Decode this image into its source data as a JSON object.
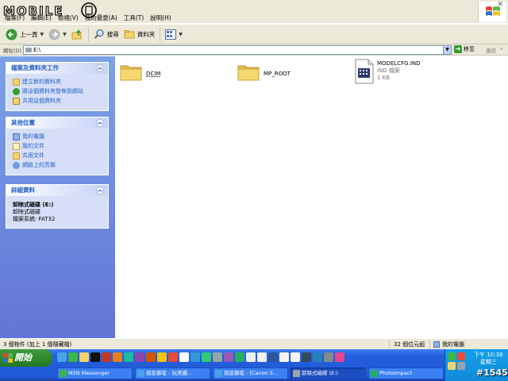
{
  "menubar": {
    "items": [
      "檔案(F)",
      "編輯(E)",
      "檢視(V)",
      "我的最愛(A)",
      "工具(T)",
      "說明(H)"
    ],
    "watermark_text": "MOBILE01"
  },
  "toolbar": {
    "back_label": "上一頁",
    "search_label": "搜尋",
    "folders_label": "資料夾"
  },
  "address": {
    "label": "網址(D)",
    "value": "E:\\",
    "go_label": "移至",
    "links_label": "連結"
  },
  "tasks_panel": {
    "title": "檔案及資料夾工作",
    "items": [
      "建立新的資料夾",
      "將這個資料夾發佈到網站",
      "共用這個資料夾"
    ]
  },
  "places_panel": {
    "title": "其他位置",
    "items": [
      "我的電腦",
      "我的文件",
      "共用文件",
      "網路上的芳鄰"
    ]
  },
  "details_panel": {
    "title": "詳細資料",
    "name": "卸除式磁碟 (E:)",
    "type": "卸除式磁碟",
    "filesystem": "檔案系統: FAT32"
  },
  "files": [
    {
      "name": "DCIM",
      "kind": "folder"
    },
    {
      "name": "MP_ROOT",
      "kind": "folder"
    },
    {
      "name": "MODELCFG.IND",
      "kind": "file",
      "type": "IND 檔案",
      "size": "1 KB"
    }
  ],
  "status": {
    "left": "3 個物件 (加上 1 個隱藏檔)",
    "size": "32 個位元組",
    "location": "我的電腦"
  },
  "taskbar": {
    "start_label": "開始",
    "tasks": [
      "MSN Messenger",
      "窩蔀慕琁 - 玩美攝...",
      "窩蔀慕琁 - [Canon 5...",
      "卸除式磁碟 (E:)",
      "PhotoImpact"
    ],
    "time": "下午 10:38",
    "day": "星期三",
    "tag": "#1545"
  },
  "colors": {
    "xp_blue": "#245edc",
    "panel_bg": "#d6dff7",
    "link_blue": "#215dc6",
    "folder_yellow": "#f3d36b"
  }
}
